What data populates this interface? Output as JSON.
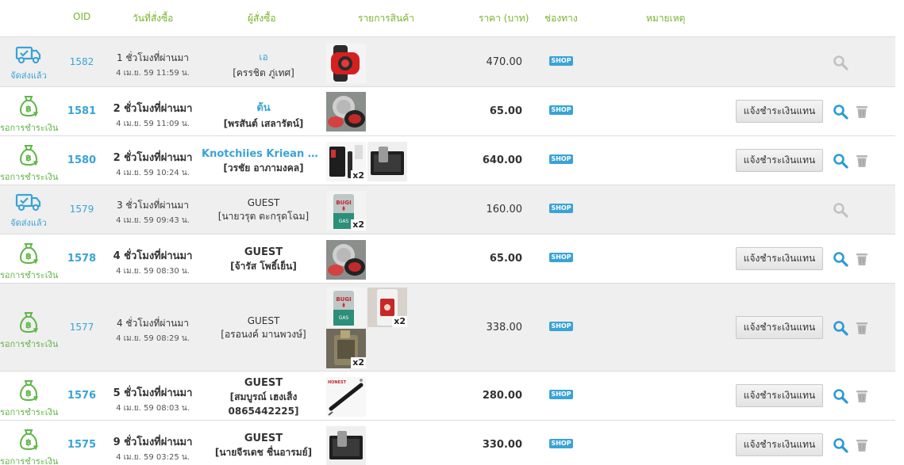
{
  "header": {
    "oid": "OID",
    "date": "วันที่สั่งซื้อ",
    "buyer": "ผู้สั่งซื้อ",
    "items": "รายการสินค้า",
    "price": "ราคา (บาท)",
    "channel": "ช่องทาง",
    "note": "หมายเหตุ"
  },
  "colors": {
    "accent_green": "#7ab32e",
    "link_blue": "#3aa3d6",
    "status_green": "#62b54a",
    "row_gray": "#efefef"
  },
  "orders": [
    {
      "status_label": "จัดส่งแล้ว",
      "status_icon": "truck-check-icon",
      "oid": "1582",
      "ago": "1 ชั่วโมงที่ผ่านมา",
      "ts": "4 เม.ย. 59 11:59 น.",
      "buyer": "เอ",
      "buyer_real": "[ครรชิต ภู่เทศ]",
      "items": [
        {
          "img": "red-watch",
          "qty": ""
        }
      ],
      "price": "470.00",
      "channel": "SHOP",
      "pay_label": ""
    },
    {
      "status_label": "รอการชำระเงิน",
      "status_icon": "money-bag-icon",
      "oid": "1581",
      "ago": "2 ชั่วโมงที่ผ่านมา",
      "ts": "4 เม.ย. 59 11:09 น.",
      "buyer": "ต้น",
      "buyer_real": "[พรสันต์ เสลารัตน์]",
      "items": [
        {
          "img": "ashtray",
          "qty": ""
        }
      ],
      "price": "65.00",
      "channel": "SHOP",
      "pay_label": "แจ้งชำระเงินแทน"
    },
    {
      "status_label": "รอการชำระเงิน",
      "status_icon": "money-bag-icon",
      "oid": "1580",
      "ago": "2 ชั่วโมงที่ผ่านมา",
      "ts": "4 เม.ย. 59 10:24 น.",
      "buyer": "Knotchiies Kriean Vivic...",
      "buyer_real": "[วรชัย อาภามงคล]",
      "items": [
        {
          "img": "lighter-black",
          "qty": "x2"
        },
        {
          "img": "lighter-box",
          "qty": ""
        }
      ],
      "price": "640.00",
      "channel": "SHOP",
      "pay_label": "แจ้งชำระเงินแทน"
    },
    {
      "status_label": "จัดส่งแล้ว",
      "status_icon": "truck-check-icon",
      "oid": "1579",
      "ago": "3 ชั่วโมงที่ผ่านมา",
      "ts": "4 เม.ย. 59 09:43 น.",
      "buyer": "GUEST",
      "buyer_real": "[นายวรุต ตะกรุดโฉม]",
      "items": [
        {
          "img": "gas-can",
          "qty": "x2"
        }
      ],
      "price": "160.00",
      "channel": "SHOP",
      "pay_label": ""
    },
    {
      "status_label": "รอการชำระเงิน",
      "status_icon": "money-bag-icon",
      "oid": "1578",
      "ago": "4 ชั่วโมงที่ผ่านมา",
      "ts": "4 เม.ย. 59 08:30 น.",
      "buyer": "GUEST",
      "buyer_real": "[จ้ารัส โพธิ์เย็น]",
      "items": [
        {
          "img": "ashtray",
          "qty": ""
        }
      ],
      "price": "65.00",
      "channel": "SHOP",
      "pay_label": "แจ้งชำระเงินแทน"
    },
    {
      "status_label": "รอการชำระเงิน",
      "status_icon": "money-bag-icon",
      "oid": "1577",
      "ago": "4 ชั่วโมงที่ผ่านมา",
      "ts": "4 เม.ย. 59 08:29 น.",
      "buyer": "GUEST",
      "buyer_real": "[อรอนงค์ มานพวงษ์]",
      "items": [
        {
          "img": "gas-can",
          "qty": ""
        },
        {
          "img": "red-lighter",
          "qty": "x2"
        },
        {
          "img": "lighter-brass",
          "qty": "x2"
        }
      ],
      "price": "338.00",
      "channel": "SHOP",
      "pay_label": "แจ้งชำระเงินแทน"
    },
    {
      "status_label": "รอการชำระเงิน",
      "status_icon": "money-bag-icon",
      "oid": "1576",
      "ago": "5 ชั่วโมงที่ผ่านมา",
      "ts": "4 เม.ย. 59 08:03 น.",
      "buyer": "GUEST",
      "buyer_real": "[สมบูรณ์ เฮงเส็ง",
      "buyer_phone": "0865442225]",
      "items": [
        {
          "img": "pen-torch",
          "qty": ""
        }
      ],
      "price": "280.00",
      "channel": "SHOP",
      "pay_label": "แจ้งชำระเงินแทน"
    },
    {
      "status_label": "รอการชำระเงิน",
      "status_icon": "money-bag-icon",
      "oid": "1575",
      "ago": "9 ชั่วโมงที่ผ่านมา",
      "ts": "4 เม.ย. 59 03:25 น.",
      "buyer": "GUEST",
      "buyer_real": "[นายจีรเดช ชื่นอารมย์]",
      "items": [
        {
          "img": "lighter-box",
          "qty": ""
        }
      ],
      "price": "330.00",
      "channel": "SHOP",
      "pay_label": "แจ้งชำระเงินแทน"
    }
  ]
}
